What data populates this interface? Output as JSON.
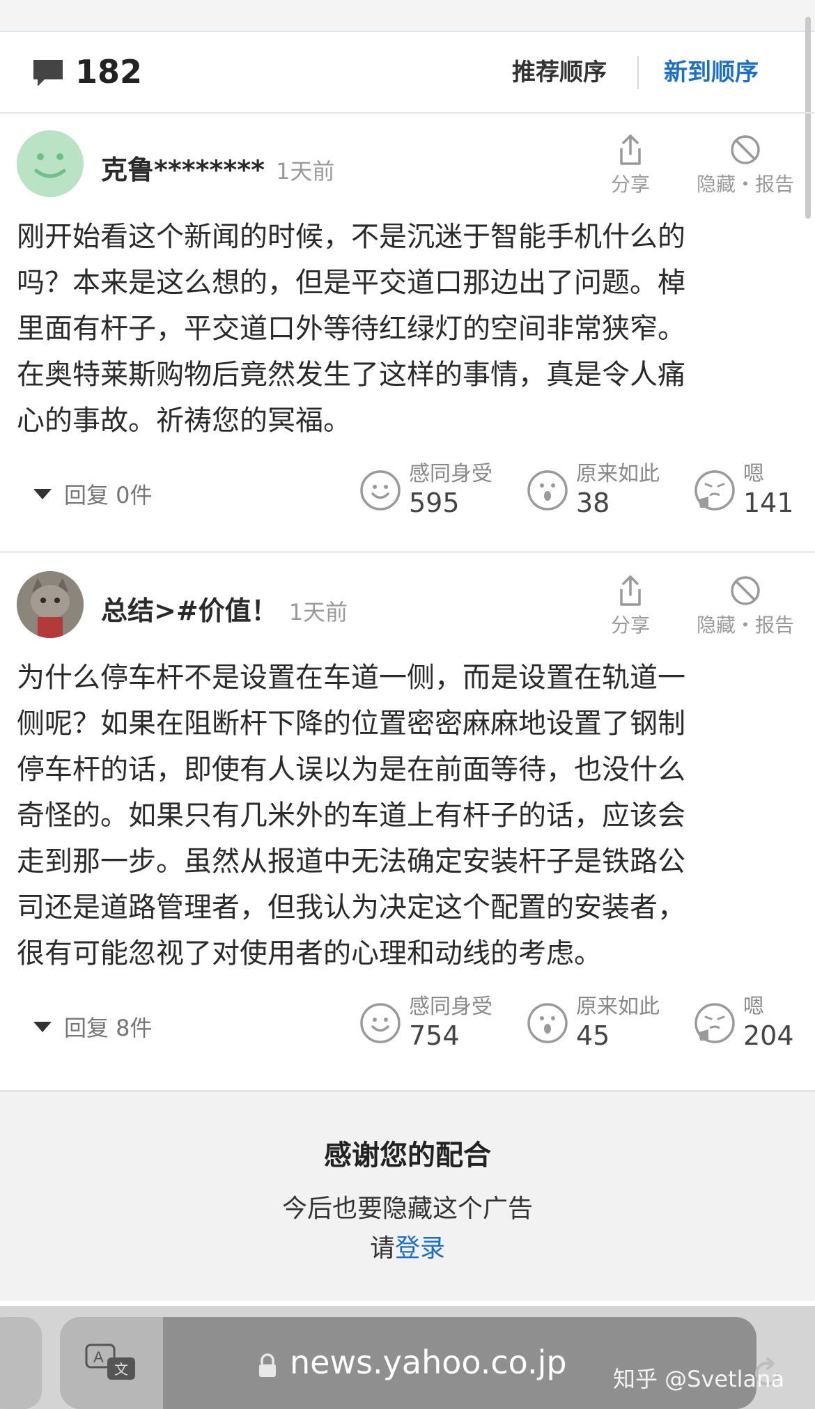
{
  "header": {
    "comment_count": "182",
    "sort_recommended": "推荐顺序",
    "sort_newest": "新到顺序"
  },
  "actions": {
    "share": "分享",
    "hide_report": "隐藏・报告"
  },
  "comments": [
    {
      "username": "克鲁********",
      "time": "1天前",
      "lines": [
        "刚开始看这个新闻的时候，不是沉迷于智能手机什么的",
        "吗？本来是这么想的，但是平交道口那边出了问题。棹",
        "里面有杆子，平交道口外等待红绿灯的空间非常狭窄。",
        "在奥特莱斯购物后竟然发生了这样的事情，真是令人痛",
        "心的事故。祈祷您的冥福。"
      ],
      "reply_label": "回复 0件",
      "reactions": [
        {
          "label": "感同身受",
          "count": "595",
          "icon": "smile-face-icon"
        },
        {
          "label": "原来如此",
          "count": "38",
          "icon": "surprised-face-icon"
        },
        {
          "label": "嗯",
          "count": "141",
          "icon": "thinking-face-icon"
        }
      ]
    },
    {
      "username": "总结>#价值！",
      "time": "1天前",
      "lines": [
        "为什么停车杆不是设置在车道一侧，而是设置在轨道一",
        "侧呢？如果在阻断杆下降的位置密密麻麻地设置了钢制",
        "停车杆的话，即使有人误以为是在前面等待，也没什么",
        "奇怪的。如果只有几米外的车道上有杆子的话，应该会",
        "走到那一步。虽然从报道中无法确定安装杆子是铁路公",
        "司还是道路管理者，但我认为决定这个配置的安装者，",
        "很有可能忽视了对使用者的心理和动线的考虑。"
      ],
      "reply_label": "回复 8件",
      "reactions": [
        {
          "label": "感同身受",
          "count": "754",
          "icon": "smile-face-icon"
        },
        {
          "label": "原来如此",
          "count": "45",
          "icon": "surprised-face-icon"
        },
        {
          "label": "嗯",
          "count": "204",
          "icon": "thinking-face-icon"
        }
      ]
    }
  ],
  "ad_notice": {
    "title": "感谢您的配合",
    "subtitle": "今后也要隐藏这个广告",
    "login_prefix": "请",
    "login_link": "登录"
  },
  "browser": {
    "host": "news.yahoo.co.jp",
    "watermark": "知乎 @Svetlana"
  },
  "colors": {
    "accent_link": "#1e6fc0",
    "avatar_green": "#b9e3c4"
  }
}
